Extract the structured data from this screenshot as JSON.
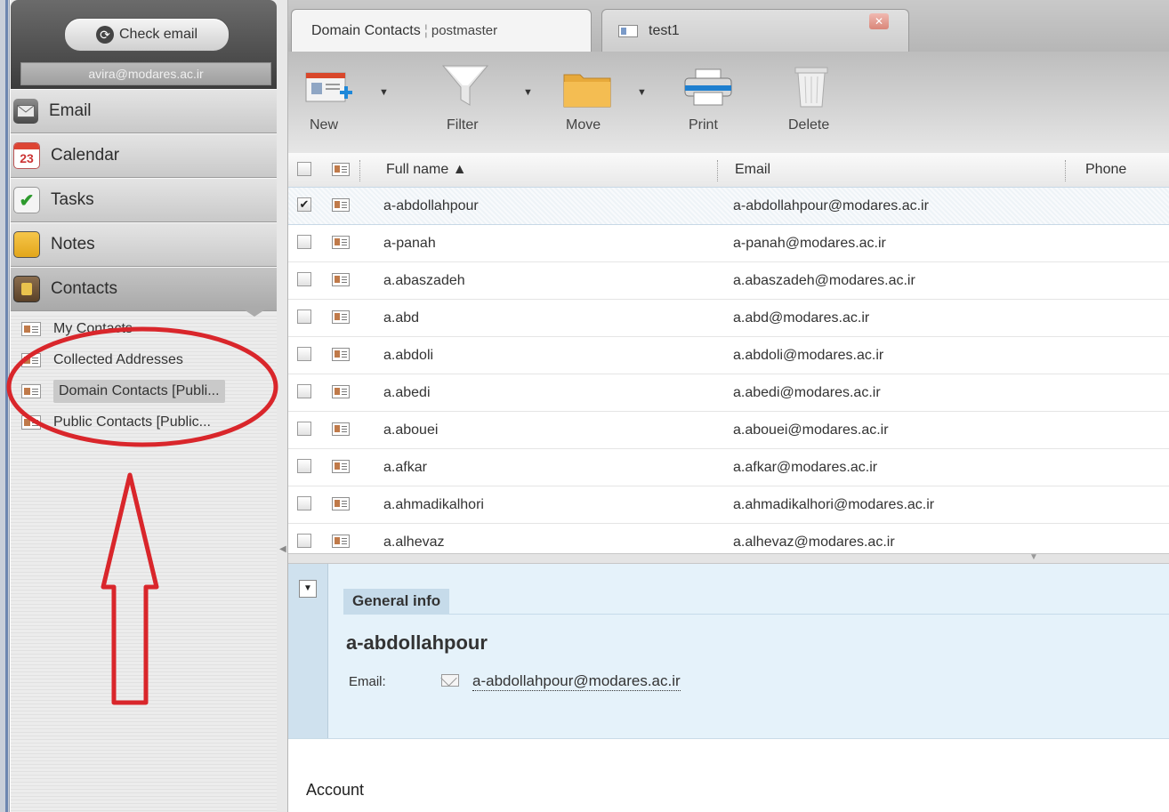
{
  "sidebar": {
    "check_email_label": "Check email",
    "account": "avira@modares.ac.ir",
    "nav": [
      {
        "label": "Email",
        "icon": "envelope-icon"
      },
      {
        "label": "Calendar",
        "icon": "calendar-icon",
        "badge": "23"
      },
      {
        "label": "Tasks",
        "icon": "checkmark-icon"
      },
      {
        "label": "Notes",
        "icon": "note-icon"
      },
      {
        "label": "Contacts",
        "icon": "address-book-icon"
      }
    ],
    "folders": [
      {
        "label": "My Contacts"
      },
      {
        "label": "Collected Addresses"
      },
      {
        "label": "Domain Contacts [Publi..."
      },
      {
        "label": "Public Contacts [Public..."
      }
    ]
  },
  "tabs": [
    {
      "title": "Domain Contacts",
      "subtitle": "postmaster"
    },
    {
      "title": "test1"
    }
  ],
  "toolbar": {
    "new_label": "New",
    "filter_label": "Filter",
    "move_label": "Move",
    "print_label": "Print",
    "delete_label": "Delete"
  },
  "grid": {
    "columns": {
      "full_name": "Full name ▲",
      "email": "Email",
      "phone": "Phone"
    },
    "rows": [
      {
        "name": "a-abdollahpour",
        "email": "a-abdollahpour@modares.ac.ir",
        "checked": true
      },
      {
        "name": "a-panah",
        "email": "a-panah@modares.ac.ir",
        "checked": false
      },
      {
        "name": "a.abaszadeh",
        "email": "a.abaszadeh@modares.ac.ir",
        "checked": false
      },
      {
        "name": "a.abd",
        "email": "a.abd@modares.ac.ir",
        "checked": false
      },
      {
        "name": "a.abdoli",
        "email": "a.abdoli@modares.ac.ir",
        "checked": false
      },
      {
        "name": "a.abedi",
        "email": "a.abedi@modares.ac.ir",
        "checked": false
      },
      {
        "name": "a.abouei",
        "email": "a.abouei@modares.ac.ir",
        "checked": false
      },
      {
        "name": "a.afkar",
        "email": "a.afkar@modares.ac.ir",
        "checked": false
      },
      {
        "name": "a.ahmadikalhori",
        "email": "a.ahmadikalhori@modares.ac.ir",
        "checked": false
      },
      {
        "name": "a.alhevaz",
        "email": "a.alhevaz@modares.ac.ir",
        "checked": false
      }
    ]
  },
  "preview": {
    "section_title": "General info",
    "contact_name": "a-abdollahpour",
    "email_label": "Email:",
    "email_value": "a-abdollahpour@modares.ac.ir",
    "account_label": "Account"
  },
  "annotation": {
    "color": "#d9262b"
  }
}
